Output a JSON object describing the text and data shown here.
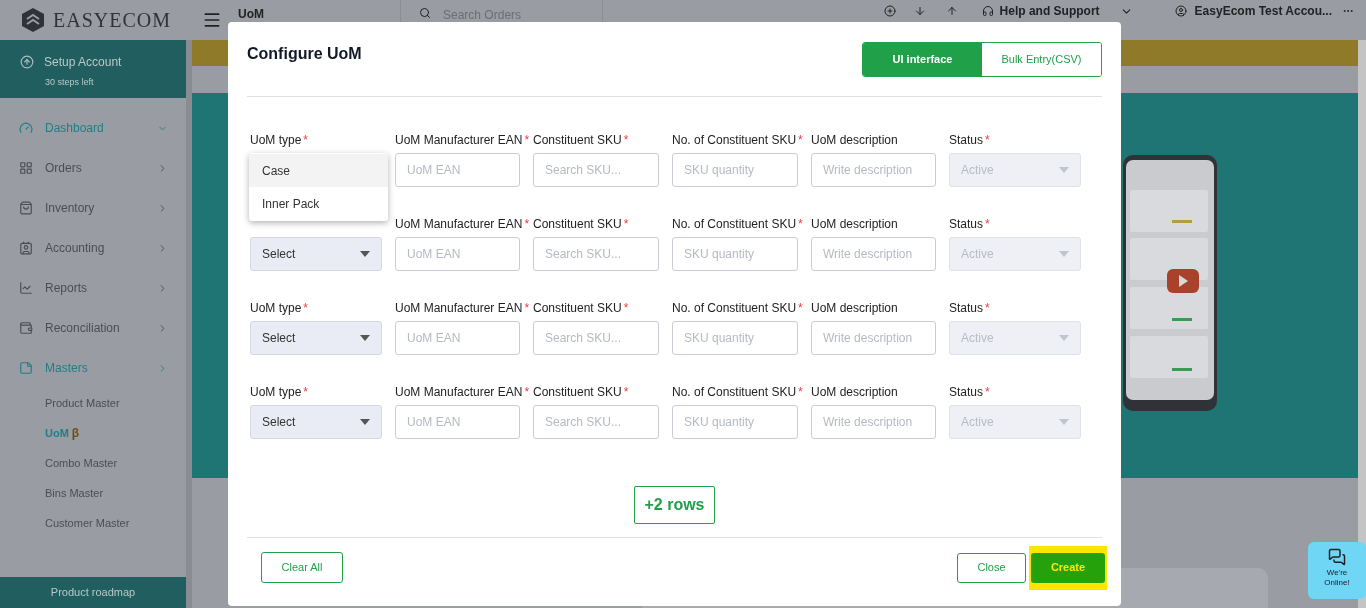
{
  "topbar": {
    "brand": "EASYECOM",
    "breadcrumb": "UoM",
    "search": {
      "placeholder": "Search Orders"
    },
    "help": "Help and Support",
    "user": "EasyEcom Test Accou..."
  },
  "sidebar": {
    "setup": {
      "title": "Setup Account",
      "subtitle": "30 steps left"
    },
    "items": [
      {
        "label": "Dashboard",
        "selected": true,
        "expanded": true
      },
      {
        "label": "Orders",
        "selected": false,
        "expanded": false
      },
      {
        "label": "Inventory",
        "selected": false,
        "expanded": false
      },
      {
        "label": "Accounting",
        "selected": false,
        "expanded": false
      },
      {
        "label": "Reports",
        "selected": false,
        "expanded": false
      },
      {
        "label": "Reconciliation",
        "selected": false,
        "expanded": false
      },
      {
        "label": "Masters",
        "selected": true,
        "expanded": false
      }
    ],
    "subitems": [
      {
        "label": "Product Master",
        "selected": false
      },
      {
        "label": "UoM",
        "badge": "β",
        "selected": true
      },
      {
        "label": "Combo Master",
        "selected": false
      },
      {
        "label": "Bins Master",
        "selected": false
      },
      {
        "label": "Customer Master",
        "selected": false
      }
    ],
    "footer": "Product roadmap"
  },
  "dialog": {
    "title": "Configure UoM",
    "mode_tabs": [
      {
        "label": "UI interface",
        "selected": true
      },
      {
        "label": "Bulk Entry(CSV)",
        "selected": false
      }
    ],
    "rows": [
      {
        "fields": [
          {
            "label": "UoM type",
            "required_mark": "*",
            "kind": "select",
            "open": true,
            "options": [
              {
                "label": "Case",
                "selected": true
              },
              {
                "label": "Inner Pack",
                "selected": false
              }
            ]
          },
          {
            "label": "UoM Manufacturer EAN",
            "required_mark": "*",
            "kind": "input",
            "placeholder": "UoM EAN"
          },
          {
            "label": "Constituent SKU",
            "required_mark": "*",
            "kind": "input",
            "placeholder": "Search SKU..."
          },
          {
            "label": "No. of Constituent SKU",
            "required_mark": "*",
            "kind": "input",
            "placeholder": "SKU quantity"
          },
          {
            "label": "UoM description",
            "kind": "input",
            "placeholder": "Write description"
          },
          {
            "label": "Status",
            "required_mark": "*",
            "kind": "select",
            "value": "Active",
            "disabled": true
          }
        ]
      },
      {
        "fields": [
          {
            "kind": "select",
            "value": "Select",
            "disabled": false
          },
          {
            "label": "UoM Manufacturer EAN",
            "required_mark": "*",
            "kind": "input",
            "placeholder": "UoM EAN"
          },
          {
            "label": "Constituent SKU",
            "required_mark": "*",
            "kind": "input",
            "placeholder": "Search SKU..."
          },
          {
            "label": "No. of Constituent SKU",
            "required_mark": "*",
            "kind": "input",
            "placeholder": "SKU quantity"
          },
          {
            "label": "UoM description",
            "kind": "input",
            "placeholder": "Write description"
          },
          {
            "label": "Status",
            "required_mark": "*",
            "kind": "select",
            "value": "Active",
            "disabled": true
          }
        ]
      },
      {
        "fields": [
          {
            "label": "UoM type",
            "required_mark": "*",
            "kind": "select",
            "value": "Select",
            "disabled": false
          },
          {
            "label": "UoM Manufacturer EAN",
            "required_mark": "*",
            "kind": "input",
            "placeholder": "UoM EAN"
          },
          {
            "label": "Constituent SKU",
            "required_mark": "*",
            "kind": "input",
            "placeholder": "Search SKU..."
          },
          {
            "label": "No. of Constituent SKU",
            "required_mark": "*",
            "kind": "input",
            "placeholder": "SKU quantity"
          },
          {
            "label": "UoM description",
            "kind": "input",
            "placeholder": "Write description"
          },
          {
            "label": "Status",
            "required_mark": "*",
            "kind": "select",
            "value": "Active",
            "disabled": true
          }
        ]
      },
      {
        "fields": [
          {
            "label": "UoM type",
            "required_mark": "*",
            "kind": "select",
            "value": "Select",
            "disabled": false
          },
          {
            "label": "UoM Manufacturer EAN",
            "required_mark": "*",
            "kind": "input",
            "placeholder": "UoM EAN"
          },
          {
            "label": "Constituent SKU",
            "required_mark": "*",
            "kind": "input",
            "placeholder": "Search SKU..."
          },
          {
            "label": "No. of Constituent SKU",
            "required_mark": "*",
            "kind": "input",
            "placeholder": "SKU quantity"
          },
          {
            "label": "UoM description",
            "kind": "input",
            "placeholder": "Write description"
          },
          {
            "label": "Status",
            "required_mark": "*",
            "kind": "select",
            "value": "Active",
            "disabled": true
          }
        ]
      }
    ],
    "add_rows": "+2 rows",
    "buttons": {
      "clear": "Clear All",
      "close": "Close",
      "create": "Create",
      "create_highlighted": true
    }
  },
  "chat": {
    "text": "We're Online!"
  }
}
